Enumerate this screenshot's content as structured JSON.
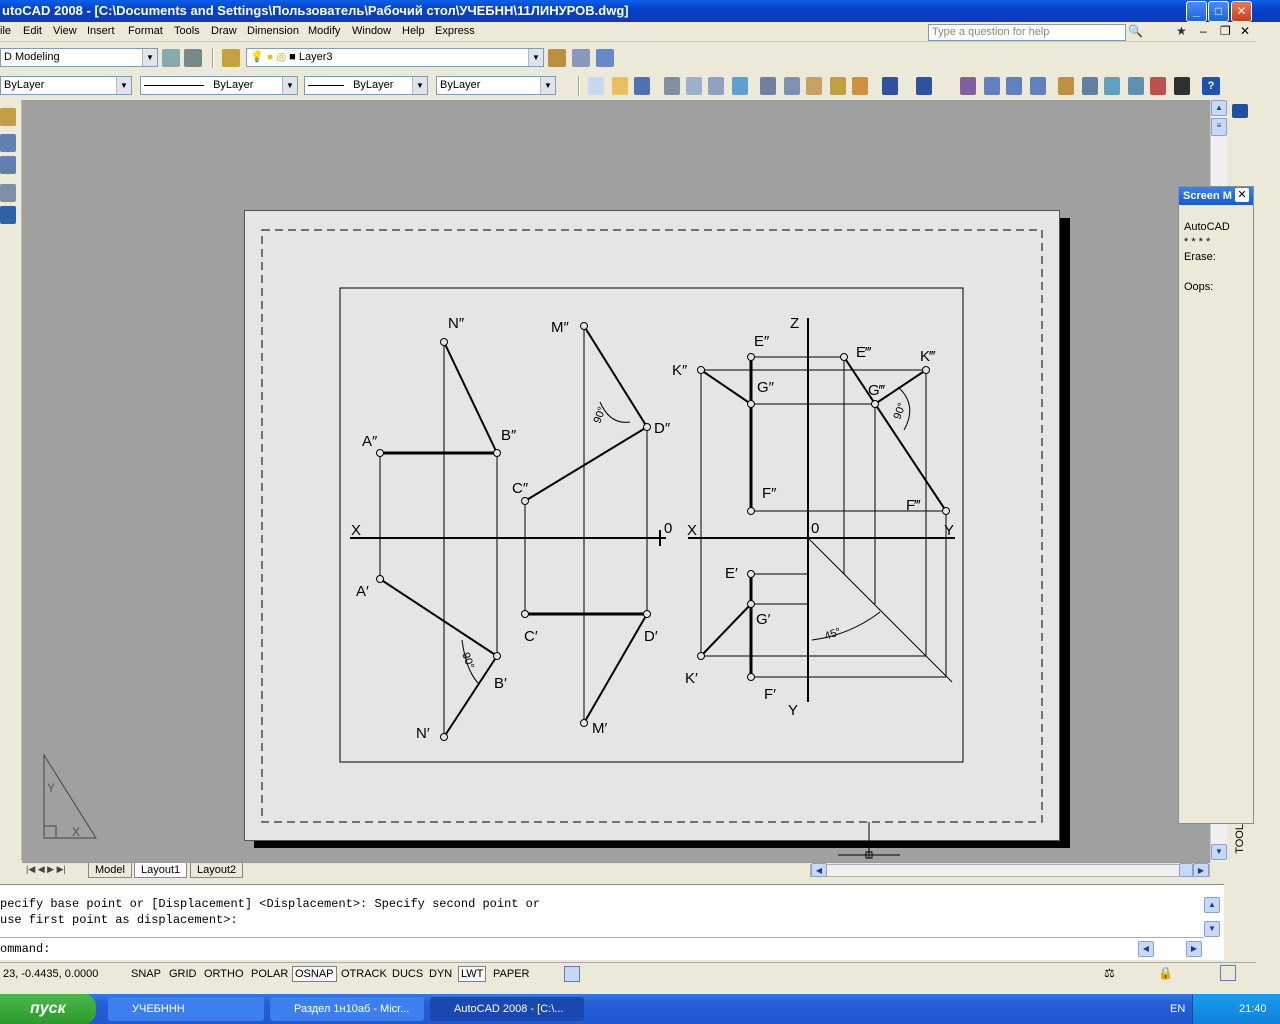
{
  "window": {
    "title": "utoCAD 2008 - [C:\\Documents and Settings\\Пользователь\\Рабочий стол\\УЧЕБНН\\11ЛИНУРОВ.dwg]",
    "help_placeholder": "Type a question for help"
  },
  "menu": [
    "ile",
    "Edit",
    "View",
    "Insert",
    "Format",
    "Tools",
    "Draw",
    "Dimension",
    "Modify",
    "Window",
    "Help",
    "Express"
  ],
  "toolbars": {
    "workspace": "D Modeling",
    "layer": "Layer3",
    "color": "ByLayer",
    "linetype": "ByLayer",
    "lineweight": "ByLayer",
    "plotstyle": "ByLayer"
  },
  "screen_menu": {
    "title": "Screen M",
    "lines": [
      "AutoCAD",
      "* * * *",
      "Erase:",
      "",
      "Oops:"
    ]
  },
  "layout_tabs": [
    "Model",
    "Layout1",
    "Layout2"
  ],
  "side_label": "TOOL",
  "command": {
    "history_1": "pecify base point or [Displacement] <Displacement>: Specify second point or",
    "history_2": "use first point as displacement>:",
    "prompt": "ommand:"
  },
  "status": {
    "coords": "23, -0.4435, 0.0000",
    "buttons": [
      {
        "label": "SNAP",
        "on": false
      },
      {
        "label": "GRID",
        "on": false
      },
      {
        "label": "ORTHO",
        "on": false
      },
      {
        "label": "POLAR",
        "on": false
      },
      {
        "label": "OSNAP",
        "on": true
      },
      {
        "label": "OTRACK",
        "on": false
      },
      {
        "label": "DUCS",
        "on": false
      },
      {
        "label": "DYN",
        "on": false
      },
      {
        "label": "LWT",
        "on": true
      },
      {
        "label": "PAPER",
        "on": false
      }
    ]
  },
  "taskbar": {
    "start": "пуск",
    "items": [
      "УЧЕБННН",
      "Раздел 1н10аб - Micr...",
      "AutoCAD 2008 - [C:\\..."
    ],
    "lang": "EN",
    "time": "21:40"
  },
  "drawing": {
    "labels": {
      "N2": "N″",
      "M2": "M″",
      "A2": "A″",
      "B2": "B″",
      "C2": "C″",
      "D2": "D″",
      "A1": "A′",
      "B1": "B′",
      "C1": "C′",
      "D1": "D′",
      "N1": "N′",
      "M1": "M′",
      "E2": "E″",
      "G2": "G″",
      "F2": "F″",
      "K2": "K″",
      "E3": "E‴",
      "G3": "G‴",
      "F3": "F‴",
      "K3": "K‴",
      "E1": "E′",
      "G1": "G′",
      "F1": "F′",
      "K1": "K′",
      "X": "X",
      "X2": "X",
      "O": "0",
      "O2": "0",
      "Y": "Y",
      "Y2": "Y",
      "Z": "Z",
      "ang1": "90°",
      "ang2": "90°",
      "ang3": "90°",
      "ang4": "45°"
    },
    "ucs": {
      "x": "X",
      "y": "Y"
    }
  }
}
